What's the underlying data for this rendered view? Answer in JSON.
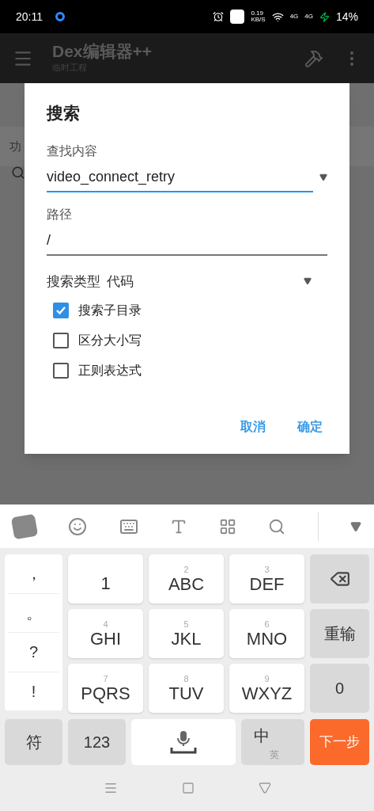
{
  "status_bar": {
    "time": "20:11",
    "speed": "0.19",
    "speed_unit": "KB/S",
    "network_labels": [
      "4G",
      "4G"
    ],
    "battery": "14%"
  },
  "app_bar": {
    "title": "Dex编辑器++",
    "subtitle": "临时工程"
  },
  "background": {
    "tab_label": "功"
  },
  "dialog": {
    "title": "搜索",
    "find_field": {
      "label": "查找内容",
      "value": "video_connect_retry",
      "focused": true
    },
    "path_field": {
      "label": "路径",
      "value": "/",
      "focused": false
    },
    "search_type": {
      "label": "搜索类型",
      "value": "代码"
    },
    "options": [
      {
        "label": "搜索子目录",
        "checked": true
      },
      {
        "label": "区分大小写",
        "checked": false
      },
      {
        "label": "正则表达式",
        "checked": false
      }
    ],
    "buttons": [
      "取消",
      "确定"
    ]
  },
  "keyboard": {
    "punctuation": [
      "，",
      "。",
      "?",
      "!"
    ],
    "one_key": "1",
    "keys": [
      {
        "number": "2",
        "letters": "ABC"
      },
      {
        "number": "3",
        "letters": "DEF"
      },
      {
        "number": "4",
        "letters": "GHI"
      },
      {
        "number": "5",
        "letters": "JKL"
      },
      {
        "number": "6",
        "letters": "MNO"
      },
      {
        "number": "7",
        "letters": "PQRS"
      },
      {
        "number": "8",
        "letters": "TUV"
      },
      {
        "number": "9",
        "letters": "WXYZ"
      }
    ],
    "side_keys": [
      {
        "kind": "icon"
      },
      {
        "kind": "text",
        "label": "重输"
      },
      {
        "kind": "text",
        "label": "0"
      }
    ],
    "bottom": {
      "symbols": "符",
      "numbers": "123",
      "lang_main": "中",
      "lang_alt": "英",
      "enter": "下一步"
    }
  }
}
